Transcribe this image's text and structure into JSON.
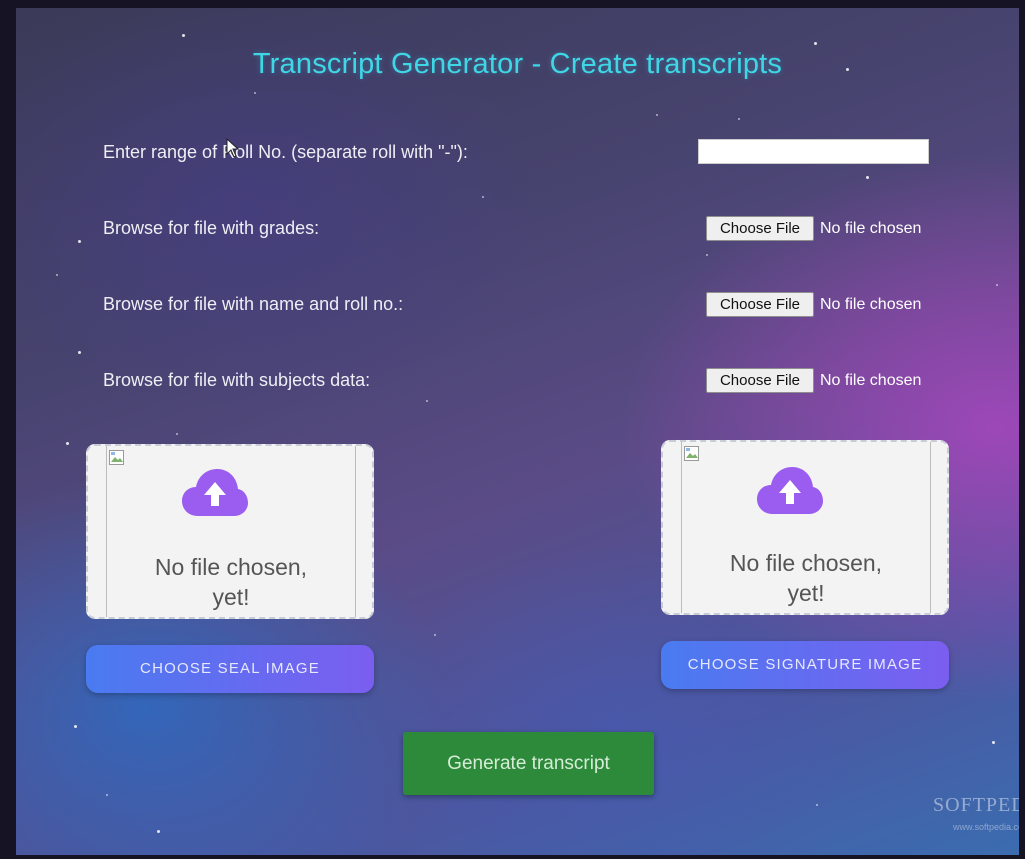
{
  "page": {
    "title": "Transcript Generator - Create transcripts"
  },
  "form": {
    "roll_label": "Enter range of Roll No. (separate roll with \"-\"):",
    "roll_value": "",
    "grades_label": "Browse for file with grades:",
    "names_label": "Browse for file with name and roll no.:",
    "subjects_label": "Browse for file with subjects data:",
    "choose_file_label": "Choose File",
    "no_file_label": "No file chosen"
  },
  "seal": {
    "status_line1": "No file chosen,",
    "status_line2": "yet!",
    "button_label": "CHOOSE SEAL IMAGE",
    "icon": "cloud-upload-icon"
  },
  "signature": {
    "status_line1": "No file chosen,",
    "status_line2": "yet!",
    "button_label": "CHOOSE SIGNATURE IMAGE",
    "icon": "cloud-upload-icon"
  },
  "actions": {
    "generate_label": "Generate transcript"
  },
  "watermark": {
    "brand": "SOFTPEDIA",
    "url": "www.softpedia.com"
  },
  "colors": {
    "title": "#3fd6e6",
    "cloud_icon": "#9b5cf0",
    "generate_button": "#2c8a3a",
    "choose_button_start": "#4a7bf0",
    "choose_button_end": "#7b5ef0"
  }
}
